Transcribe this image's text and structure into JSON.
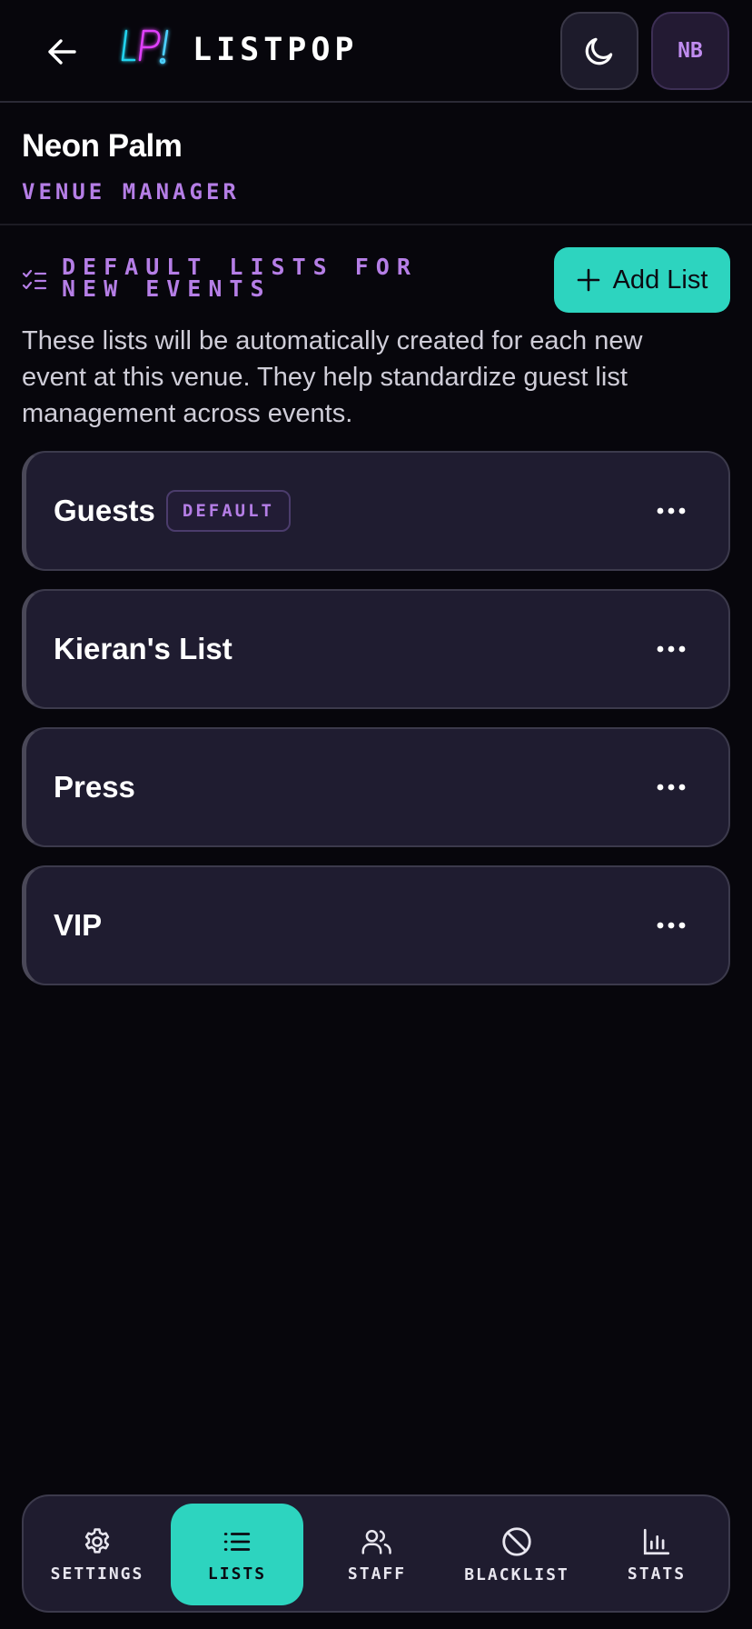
{
  "header": {
    "back_icon": "arrow-left-icon",
    "logo_text": "LP!",
    "brand": "LISTPOP",
    "theme_icon": "moon-icon",
    "avatar_initials": "NB"
  },
  "venue": {
    "name": "Neon Palm",
    "role": "VENUE MANAGER"
  },
  "section": {
    "icon": "list-checks-icon",
    "title": "DEFAULT LISTS FOR NEW EVENTS",
    "add_button_label": "Add List",
    "add_icon": "plus-icon",
    "description": "These lists will be automatically created for each new event at this venue. They help standardize guest list management across events."
  },
  "lists": [
    {
      "name": "Guests",
      "badge": "DEFAULT"
    },
    {
      "name": "Kieran's List"
    },
    {
      "name": "Press"
    },
    {
      "name": "VIP"
    }
  ],
  "bottom_nav": {
    "items": [
      {
        "label": "SETTINGS",
        "icon": "gear-icon",
        "active": false
      },
      {
        "label": "LISTS",
        "icon": "list-icon",
        "active": true
      },
      {
        "label": "STAFF",
        "icon": "users-icon",
        "active": false
      },
      {
        "label": "BLACKLIST",
        "icon": "ban-icon",
        "active": false
      },
      {
        "label": "STATS",
        "icon": "bar-chart-icon",
        "active": false
      }
    ]
  },
  "colors": {
    "background": "#07060c",
    "accent_teal": "#2dd4bf",
    "accent_purple": "#b57ee6",
    "card": "#1f1c30"
  }
}
